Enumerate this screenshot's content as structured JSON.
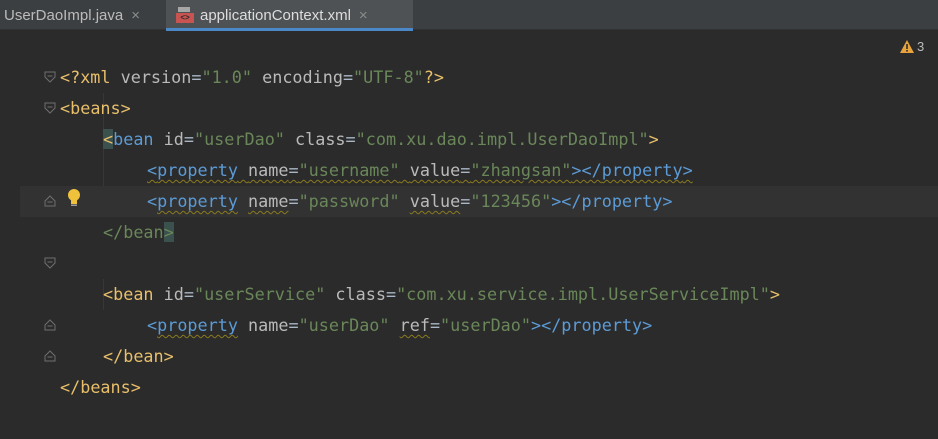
{
  "tabs": [
    {
      "label": "UserDaoImpl.java",
      "close": "×"
    },
    {
      "label": "applicationContext.xml",
      "close": "×",
      "icon": "xml-file-icon",
      "active": true
    }
  ],
  "warnings": {
    "count": "3",
    "icon": "warning-icon"
  },
  "code": {
    "l1": {
      "a": "<?xml ",
      "b": "version",
      "c": "=",
      "d": "\"1.0\"",
      "e": " ",
      "f": "encoding",
      "g": "=",
      "h": "\"UTF-8\"",
      "i": "?>"
    },
    "l2": {
      "a": "<",
      "b": "beans",
      ">": ">"
    },
    "l3": {
      "a": "<",
      "b": "bean",
      "c": " ",
      "d": "id",
      "e": "=",
      "f": "\"userDao\"",
      "g": " ",
      "h": "class",
      "i": "=",
      "j": "\"com.xu.dao.impl.UserDaoImpl\"",
      "k": ">"
    },
    "l4": {
      "a": "<",
      "b": "property",
      "c": " ",
      "d": "name",
      "e": "=",
      "f": "\"username\"",
      "g": " ",
      "h": "value",
      "i": "=",
      "j": "\"zhangsan\"",
      "k": "></",
      "l": "property",
      "m": ">"
    },
    "l5": {
      "a": "<",
      "b": "property",
      "c": " ",
      "d": "name",
      "e": "=",
      "f": "\"password\"",
      "g": " ",
      "h": "value",
      "i": "=",
      "j": "\"123456\"",
      "k": "></",
      "l": "property",
      "m": ">"
    },
    "l6": {
      "a": "</",
      "b": "bean",
      "c": ">"
    },
    "l8": {
      "a": "<",
      "b": "bean",
      "c": " ",
      "d": "id",
      "e": "=",
      "f": "\"userService\"",
      "g": " ",
      "h": "class",
      "i": "=",
      "j": "\"com.xu.service.impl.UserServiceImpl\"",
      "k": ">"
    },
    "l9": {
      "a": "<",
      "b": "property",
      "c": " ",
      "d": "name",
      "e": "=",
      "f": "\"userDao\"",
      "g": " ",
      "h": "ref",
      "i": "=",
      "j": "\"userDao\"",
      "k": "></",
      "l": "property",
      "m": ">"
    },
    "l10": {
      "a": "</",
      "b": "bean",
      "c": ">"
    },
    "l11": {
      "a": "</",
      "b": "beans",
      "c": ">"
    }
  },
  "colors": {
    "tag": "#e8bf6a",
    "attribute": "#bababa",
    "value": "#6a8759",
    "bracket": "#5c9bd6",
    "background": "#2b2b2b"
  }
}
